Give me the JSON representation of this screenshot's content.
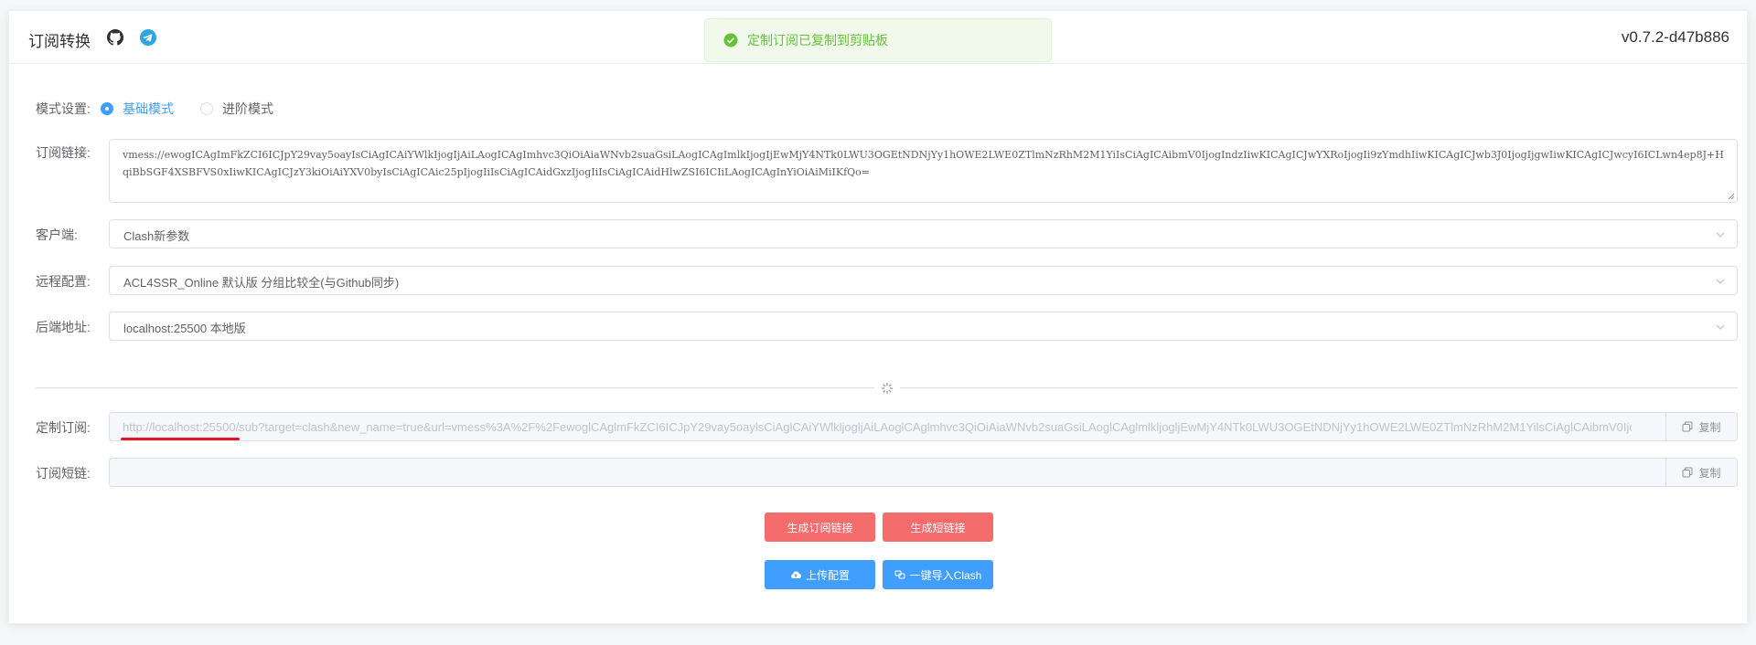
{
  "header": {
    "title": "订阅转换",
    "version": "v0.7.2-d47b886"
  },
  "toast": {
    "message": "定制订阅已复制到剪贴板"
  },
  "form": {
    "mode": {
      "label": "模式设置:",
      "options": [
        {
          "label": "基础模式",
          "selected": true
        },
        {
          "label": "进阶模式",
          "selected": false
        }
      ]
    },
    "subscription": {
      "label": "订阅链接:",
      "value": "vmess://ewogICAgImFkZCI6ICJpY29vay5oayIsCiAgICAiYWlkIjogIjAiLAogICAgImhvc3QiOiAiaWNvb2suaGsiLAogICAgImlkIjogIjEwMjY4NTk0LWU3OGEtNDNjYy1hOWE2LWE0ZTlmNzRhM2M1YiIsCiAgICAibmV0IjogIndzIiwKICAgICJwYXRoIjogIi9zYmdhIiwKICAgICJwb3J0IjogIjgwIiwKICAgICJwcyI6ICLwn4ep8J+HqiBbSGF4XSBFVS0xIiwKICAgICJzY3kiOiAiYXV0byIsCiAgICAic25pIjogIiIsCiAgICAidGxzIjogIiIsCiAgICAidHlwZSI6ICIiLAogICAgInYiOiAiMiIKfQo="
    },
    "client": {
      "label": "客户端:",
      "value": "Clash新参数"
    },
    "remote_config": {
      "label": "远程配置:",
      "value": "ACL4SSR_Online 默认版 分组比较全(与Github同步)"
    },
    "backend": {
      "label": "后端地址:",
      "value": "localhost:25500 本地版"
    },
    "custom_sub": {
      "label": "定制订阅:",
      "value": "http://localhost:25500/sub?target=clash&new_name=true&url=vmess%3A%2F%2FewoglCAglmFkZCI6ICJpY29vay5oaylsCiAglCAiYWlkljogljAiLAoglCAglmhvc3QiOiAiaWNvb2suaGsiLAoglCAglmlkljogljEwMjY4NTk0LWU3OGEtNDNjYy1hOWE2LWE0ZTlmNzRhM2M1YilsCiAglCAibmV0Ijog",
      "copy_label": "复制"
    },
    "short_link": {
      "label": "订阅短链:",
      "value": "",
      "copy_label": "复制"
    }
  },
  "actions": {
    "generate_sub": "生成订阅链接",
    "generate_short": "生成短链接",
    "upload_config": "上传配置",
    "import_clash": "一键导入Clash"
  },
  "colors": {
    "primary": "#409eff",
    "danger": "#f56c6c",
    "success": "#67c23a",
    "annotation": "#e0192a"
  },
  "icons": [
    "github-icon",
    "telegram-icon",
    "success-check-icon",
    "chevron-down-icon",
    "copy-icon",
    "cloud-upload-icon",
    "import-icon",
    "magic-icon"
  ]
}
